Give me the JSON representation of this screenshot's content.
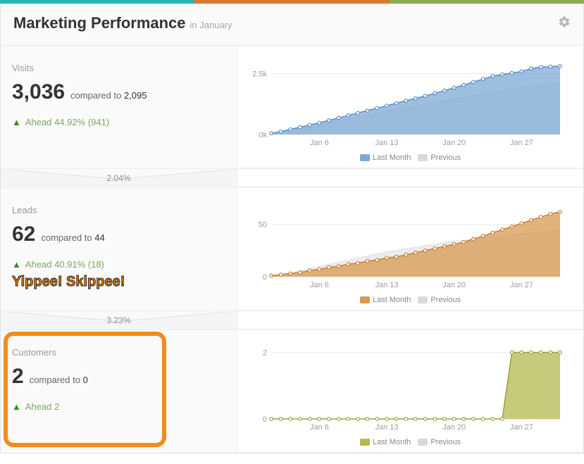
{
  "colors": {
    "blue": "#7fa9d6",
    "blue_line": "#5a8fcb",
    "orange": "#d99a51",
    "orange_line": "#c8803b",
    "olive": "#b1b94f",
    "olive_line": "#99a23a",
    "grey_fill": "#d9d9d9",
    "grey_line": "#cfcfcf",
    "stripe_teal": "#2fb1b3",
    "stripe_orange": "#d77a2d",
    "stripe_green": "#8aad52"
  },
  "header": {
    "title": "Marketing Performance",
    "subtitle": "in January"
  },
  "legend": {
    "current": "Last Month",
    "previous": "Previous"
  },
  "funnel": {
    "visits_to_leads": "2.04%",
    "leads_to_customers": "3.23%"
  },
  "metrics": {
    "visits": {
      "title": "Visits",
      "value": "3,036",
      "compared_label": "compared to",
      "prev": "2,095",
      "trend": "Ahead 44.92% (941)"
    },
    "leads": {
      "title": "Leads",
      "value": "62",
      "compared_label": "compared to",
      "prev": "44",
      "trend": "Ahead 40.91% (18)",
      "annotation": "Yippee! Skippee!"
    },
    "customers": {
      "title": "Customers",
      "value": "2",
      "compared_label": "compared to",
      "prev": "0",
      "trend": "Ahead 2"
    }
  },
  "chart_data": [
    {
      "id": "visits",
      "type": "area",
      "title": "Visits",
      "xlabel": "",
      "ylabel": "",
      "ylim": [
        0,
        3000
      ],
      "y_ticks": [
        0,
        2500
      ],
      "y_tick_labels": [
        "0k",
        "2.5k"
      ],
      "x_tick_labels": [
        "Jan 6",
        "Jan 13",
        "Jan 20",
        "Jan 27"
      ],
      "x": [
        1,
        2,
        3,
        4,
        5,
        6,
        7,
        8,
        9,
        10,
        11,
        12,
        13,
        14,
        15,
        16,
        17,
        18,
        19,
        20,
        21,
        22,
        23,
        24,
        25,
        26,
        27,
        28,
        29,
        30,
        31
      ],
      "series": [
        {
          "name": "Last Month",
          "values": [
            50,
            120,
            210,
            300,
            390,
            480,
            580,
            680,
            780,
            880,
            980,
            1080,
            1180,
            1280,
            1380,
            1480,
            1580,
            1690,
            1800,
            1910,
            2030,
            2150,
            2270,
            2390,
            2460,
            2520,
            2580,
            2700,
            2760,
            2780,
            2800
          ]
        },
        {
          "name": "Previous",
          "values": [
            40,
            100,
            170,
            250,
            330,
            410,
            490,
            570,
            650,
            730,
            810,
            890,
            970,
            1050,
            1120,
            1190,
            1260,
            1330,
            1400,
            1470,
            1540,
            1610,
            1680,
            1750,
            1820,
            1880,
            1940,
            2000,
            2060,
            2110,
            2160
          ]
        }
      ],
      "legend_position": "bottom"
    },
    {
      "id": "leads",
      "type": "area",
      "title": "Leads",
      "xlabel": "",
      "ylabel": "",
      "ylim": [
        0,
        70
      ],
      "y_ticks": [
        0,
        50
      ],
      "y_tick_labels": [
        "0",
        "50"
      ],
      "x_tick_labels": [
        "Jan 6",
        "Jan 13",
        "Jan 20",
        "Jan 27"
      ],
      "x": [
        1,
        2,
        3,
        4,
        5,
        6,
        7,
        8,
        9,
        10,
        11,
        12,
        13,
        14,
        15,
        16,
        17,
        18,
        19,
        20,
        21,
        22,
        23,
        24,
        25,
        26,
        27,
        28,
        29,
        30,
        31
      ],
      "series": [
        {
          "name": "Last Month",
          "values": [
            1,
            2,
            3,
            4,
            6,
            7,
            9,
            10,
            12,
            13,
            15,
            16,
            18,
            19,
            21,
            23,
            25,
            27,
            29,
            31,
            33,
            36,
            39,
            42,
            45,
            48,
            51,
            54,
            57,
            60,
            62
          ]
        },
        {
          "name": "Previous",
          "values": [
            1,
            2,
            4,
            6,
            8,
            10,
            12,
            14,
            16,
            18,
            20,
            22,
            24,
            25,
            27,
            28,
            30,
            31,
            33,
            34,
            35,
            36,
            37,
            38,
            39,
            40,
            41,
            42,
            43,
            44,
            45
          ]
        }
      ],
      "legend_position": "bottom"
    },
    {
      "id": "customers",
      "type": "area",
      "title": "Customers",
      "xlabel": "",
      "ylabel": "",
      "ylim": [
        0,
        2.2
      ],
      "y_ticks": [
        0,
        2
      ],
      "y_tick_labels": [
        "0",
        "2"
      ],
      "x_tick_labels": [
        "Jan 6",
        "Jan 13",
        "Jan 20",
        "Jan 27"
      ],
      "x": [
        1,
        2,
        3,
        4,
        5,
        6,
        7,
        8,
        9,
        10,
        11,
        12,
        13,
        14,
        15,
        16,
        17,
        18,
        19,
        20,
        21,
        22,
        23,
        24,
        25,
        26,
        27,
        28,
        29,
        30,
        31
      ],
      "series": [
        {
          "name": "Last Month",
          "values": [
            0,
            0,
            0,
            0,
            0,
            0,
            0,
            0,
            0,
            0,
            0,
            0,
            0,
            0,
            0,
            0,
            0,
            0,
            0,
            0,
            0,
            0,
            0,
            0,
            0,
            2,
            2,
            2,
            2,
            2,
            2
          ]
        },
        {
          "name": "Previous",
          "values": [
            0,
            0,
            0,
            0,
            0,
            0,
            0,
            0,
            0,
            0,
            0,
            0,
            0,
            0,
            0,
            0,
            0,
            0,
            0,
            0,
            0,
            0,
            0,
            0,
            0,
            0,
            0,
            0,
            0,
            0,
            0
          ]
        }
      ],
      "legend_position": "bottom"
    }
  ]
}
